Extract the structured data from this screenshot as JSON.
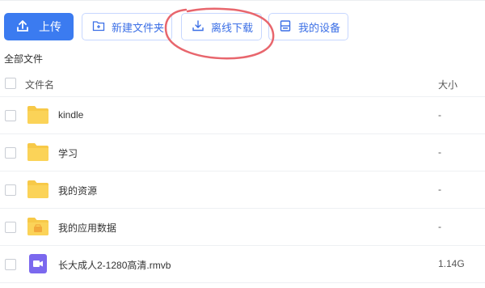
{
  "toolbar": {
    "upload_label": "上传",
    "new_folder_label": "新建文件夹",
    "offline_download_label": "离线下载",
    "my_devices_label": "我的设备"
  },
  "breadcrumb": {
    "label": "全部文件"
  },
  "table": {
    "col_name": "文件名",
    "col_size": "大小",
    "rows": [
      {
        "name": "kindle",
        "size": "-",
        "icon": "folder-icon"
      },
      {
        "name": "学习",
        "size": "-",
        "icon": "folder-icon"
      },
      {
        "name": "我的资源",
        "size": "-",
        "icon": "folder-icon"
      },
      {
        "name": "我的应用数据",
        "size": "-",
        "icon": "app-data-folder-icon"
      },
      {
        "name": "长大成人2-1280高清.rmvb",
        "size": "1.14G",
        "icon": "video-file-icon"
      }
    ]
  },
  "colors": {
    "accent": "#3b7bf0",
    "folder": "#f7c948",
    "video": "#7b68ee",
    "annotation": "#e8666d"
  }
}
